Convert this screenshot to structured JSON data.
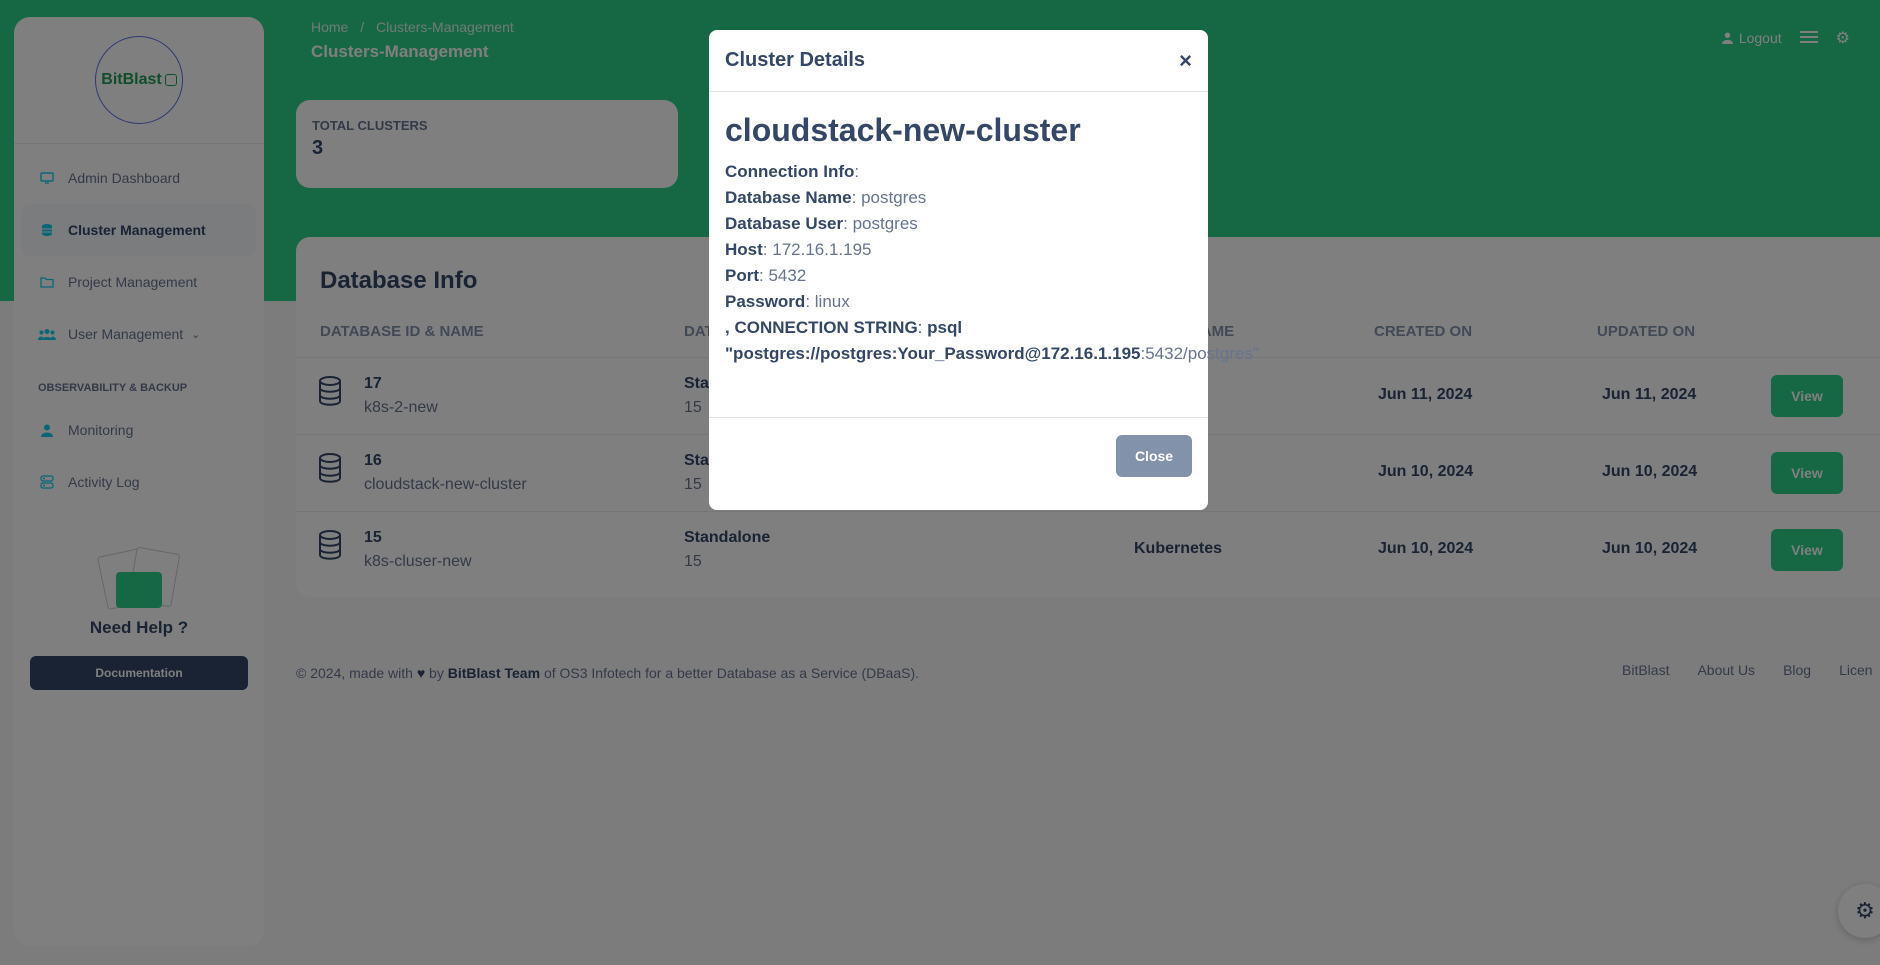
{
  "sidebar": {
    "logo_text": "BitBlast",
    "items": [
      {
        "label": "Admin Dashboard",
        "icon": "monitor-icon"
      },
      {
        "label": "Cluster Management",
        "icon": "database-icon"
      },
      {
        "label": "Project Management",
        "icon": "folder-icon"
      },
      {
        "label": "User Management",
        "icon": "users-icon"
      }
    ],
    "section_title": "OBSERVABILITY & BACKUP",
    "section_items": [
      {
        "label": "Monitoring",
        "icon": "user-icon"
      },
      {
        "label": "Activity Log",
        "icon": "activity-log-icon"
      }
    ],
    "help_title": "Need Help ?",
    "doc_button": "Documentation"
  },
  "header": {
    "breadcrumb_home": "Home",
    "breadcrumb_sep": "/",
    "breadcrumb_current": "Clusters-Management",
    "title": "Clusters-Management",
    "logout": "Logout"
  },
  "stat": {
    "label": "TOTAL CLUSTERS",
    "value": "3"
  },
  "table": {
    "title": "Database Info",
    "headers": [
      "DATABASE ID & NAME",
      "DAT",
      "NAME",
      "CREATED ON",
      "UPDATED ON"
    ],
    "rows": [
      {
        "id": "17",
        "name": "k8s-2-new",
        "type": "Sta",
        "version": "15",
        "platform": "es",
        "created": "Jun 11, 2024",
        "updated": "Jun 11, 2024",
        "action": "View"
      },
      {
        "id": "16",
        "name": "cloudstack-new-cluster",
        "type": "Sta",
        "version": "15",
        "platform": "ck",
        "created": "Jun 10, 2024",
        "updated": "Jun 10, 2024",
        "action": "View"
      },
      {
        "id": "15",
        "name": "k8s-cluser-new",
        "type": "Standalone",
        "version": "15",
        "platform": "Kubernetes",
        "created": "Jun 10, 2024",
        "updated": "Jun 10, 2024",
        "action": "View"
      }
    ]
  },
  "footer": {
    "prefix": "© 2024, made with",
    "by": "by",
    "team": "BitBlast Team",
    "suffix": "of OS3 Infotech for a better Database as a Service (DBaaS).",
    "links": [
      "BitBlast",
      "About Us",
      "Blog",
      "Licen"
    ]
  },
  "modal": {
    "title": "Cluster Details",
    "close_x": "×",
    "cluster_name": "cloudstack-new-cluster",
    "connection_info_label": "Connection Info",
    "db_name_label": "Database Name",
    "db_name": "postgres",
    "db_user_label": "Database User",
    "db_user": "postgres",
    "host_label": "Host",
    "host": "172.16.1.195",
    "port_label": "Port",
    "port": "5432",
    "password_label": "Password",
    "password": "linux",
    "conn_string_label": ", CONNECTION STRING",
    "conn_cmd": "psql",
    "conn_string_bold": "\"postgres://postgres:Your_Password@172.16.1.195",
    "conn_string_rest": ":5432/postgres\"",
    "close_button": "Close"
  },
  "colors": {
    "brand_green": "#2dce89",
    "dark": "#344767",
    "muted": "#67748e",
    "close_grey": "#8392ab"
  }
}
